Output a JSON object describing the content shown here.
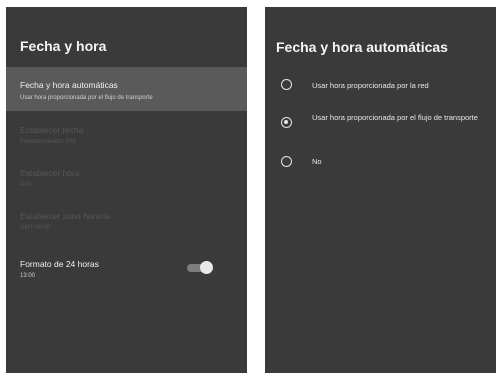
{
  "left_panel": {
    "title": "Fecha y hora",
    "items": [
      {
        "title": "Fecha y hora automáticas",
        "subtitle": "Usar hora proporcionada por el flujo de transporte"
      },
      {
        "title": "Establecer fecha",
        "subtitle": "Predeterminado: PM"
      },
      {
        "title": "Establecer hora",
        "subtitle": "4:41"
      },
      {
        "title": "Establecer zona horaria",
        "subtitle": "GMT-06:00"
      },
      {
        "title": "Formato de 24 horas",
        "subtitle": "13:00"
      }
    ],
    "toggle_24h_on": true
  },
  "right_panel": {
    "title": "Fecha y hora automáticas",
    "options": [
      {
        "label": "Usar hora proporcionada por la red",
        "selected": false
      },
      {
        "label": "Usar hora proporcionada por el flujo de transporte",
        "selected": true
      },
      {
        "label": "No",
        "selected": false
      }
    ]
  }
}
